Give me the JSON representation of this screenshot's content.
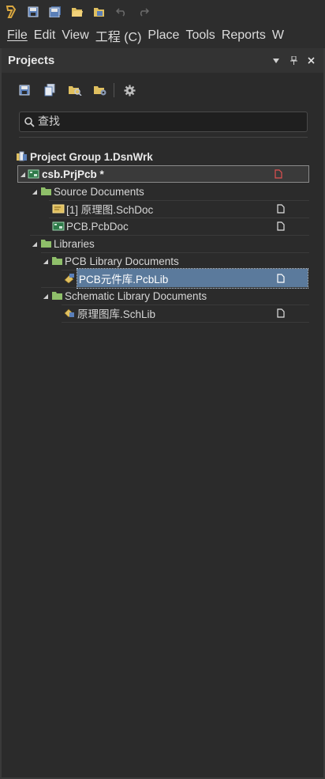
{
  "quick_access": {
    "icons": [
      "app-logo-icon",
      "save-icon",
      "save-all-icon",
      "open-icon",
      "open-project-icon",
      "undo-icon",
      "redo-icon"
    ]
  },
  "menu": {
    "items": [
      {
        "label": "File"
      },
      {
        "label": "Edit"
      },
      {
        "label": "View"
      },
      {
        "label": "工程 (C)"
      },
      {
        "label": "Place"
      },
      {
        "label": "Tools"
      },
      {
        "label": "Reports"
      },
      {
        "label": "W"
      }
    ]
  },
  "panel": {
    "title": "Projects",
    "header_buttons": [
      "menu-arrow-icon",
      "pin-icon",
      "close-icon"
    ],
    "toolbar_icons": [
      "save-icon",
      "copy-icon",
      "folder-search-icon",
      "folder-settings-icon",
      "gear-icon"
    ],
    "search": {
      "value": "查找",
      "placeholder": "查找"
    }
  },
  "tree": {
    "group": {
      "label": "Project Group 1.DsnWrk"
    },
    "project": {
      "label": "csb.PrjPcb *"
    },
    "source_folder": {
      "label": "Source Documents"
    },
    "sch_doc": {
      "label": "[1] 原理图.SchDoc"
    },
    "pcb_doc": {
      "label": "PCB.PcbDoc"
    },
    "libraries": {
      "label": "Libraries"
    },
    "pcb_lib_folder": {
      "label": "PCB Library Documents"
    },
    "pcb_lib": {
      "label": "PCB元件库.PcbLib"
    },
    "sch_lib_folder": {
      "label": "Schematic Library Documents"
    },
    "sch_lib": {
      "label": "原理图库.SchLib"
    }
  },
  "colors": {
    "accent_selection": "#5b7a9c",
    "folder": "#8fbf6a",
    "modified_doc": "#e05050"
  }
}
